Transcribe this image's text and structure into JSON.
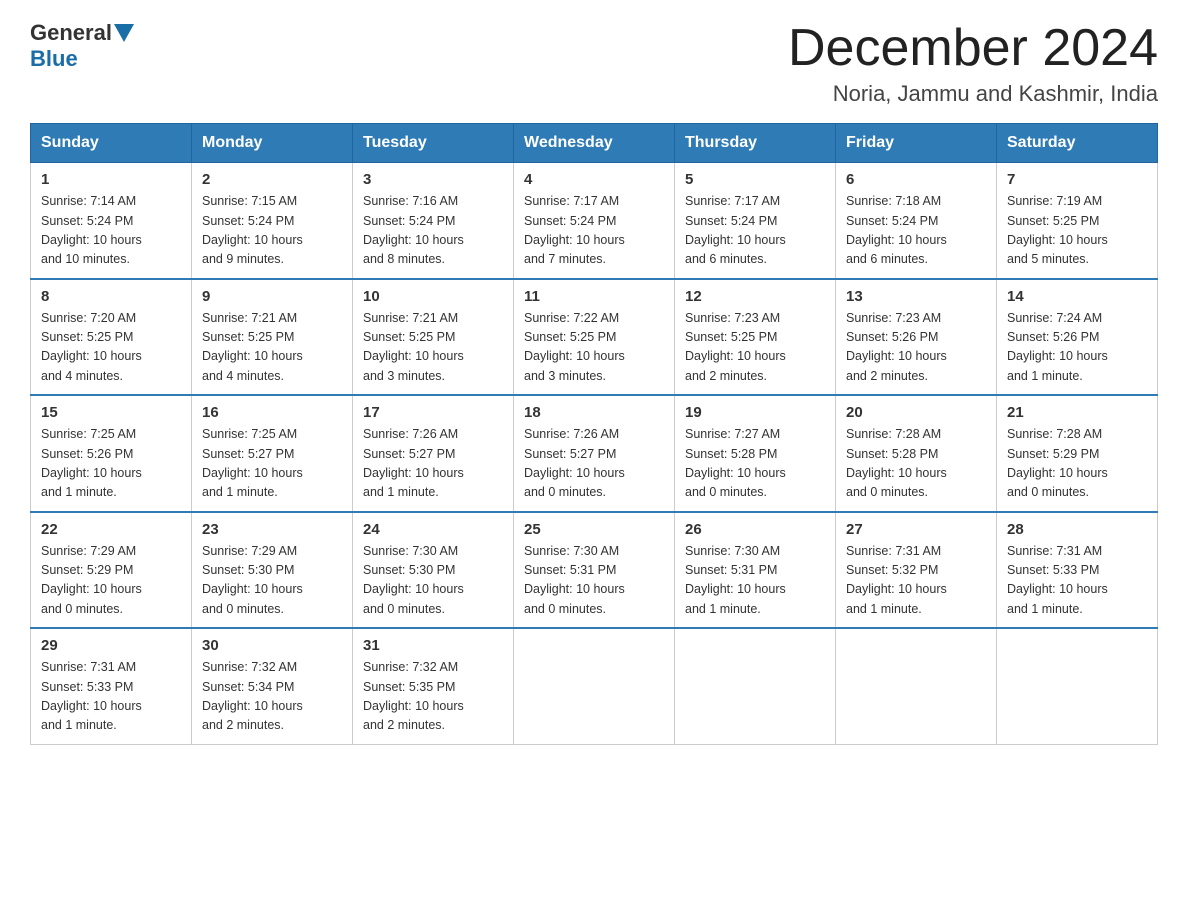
{
  "header": {
    "logo_general": "General",
    "logo_blue": "Blue",
    "month_title": "December 2024",
    "location": "Noria, Jammu and Kashmir, India"
  },
  "days_of_week": [
    "Sunday",
    "Monday",
    "Tuesday",
    "Wednesday",
    "Thursday",
    "Friday",
    "Saturday"
  ],
  "weeks": [
    [
      {
        "day": "1",
        "sunrise": "7:14 AM",
        "sunset": "5:24 PM",
        "daylight": "10 hours and 10 minutes."
      },
      {
        "day": "2",
        "sunrise": "7:15 AM",
        "sunset": "5:24 PM",
        "daylight": "10 hours and 9 minutes."
      },
      {
        "day": "3",
        "sunrise": "7:16 AM",
        "sunset": "5:24 PM",
        "daylight": "10 hours and 8 minutes."
      },
      {
        "day": "4",
        "sunrise": "7:17 AM",
        "sunset": "5:24 PM",
        "daylight": "10 hours and 7 minutes."
      },
      {
        "day": "5",
        "sunrise": "7:17 AM",
        "sunset": "5:24 PM",
        "daylight": "10 hours and 6 minutes."
      },
      {
        "day": "6",
        "sunrise": "7:18 AM",
        "sunset": "5:24 PM",
        "daylight": "10 hours and 6 minutes."
      },
      {
        "day": "7",
        "sunrise": "7:19 AM",
        "sunset": "5:25 PM",
        "daylight": "10 hours and 5 minutes."
      }
    ],
    [
      {
        "day": "8",
        "sunrise": "7:20 AM",
        "sunset": "5:25 PM",
        "daylight": "10 hours and 4 minutes."
      },
      {
        "day": "9",
        "sunrise": "7:21 AM",
        "sunset": "5:25 PM",
        "daylight": "10 hours and 4 minutes."
      },
      {
        "day": "10",
        "sunrise": "7:21 AM",
        "sunset": "5:25 PM",
        "daylight": "10 hours and 3 minutes."
      },
      {
        "day": "11",
        "sunrise": "7:22 AM",
        "sunset": "5:25 PM",
        "daylight": "10 hours and 3 minutes."
      },
      {
        "day": "12",
        "sunrise": "7:23 AM",
        "sunset": "5:25 PM",
        "daylight": "10 hours and 2 minutes."
      },
      {
        "day": "13",
        "sunrise": "7:23 AM",
        "sunset": "5:26 PM",
        "daylight": "10 hours and 2 minutes."
      },
      {
        "day": "14",
        "sunrise": "7:24 AM",
        "sunset": "5:26 PM",
        "daylight": "10 hours and 1 minute."
      }
    ],
    [
      {
        "day": "15",
        "sunrise": "7:25 AM",
        "sunset": "5:26 PM",
        "daylight": "10 hours and 1 minute."
      },
      {
        "day": "16",
        "sunrise": "7:25 AM",
        "sunset": "5:27 PM",
        "daylight": "10 hours and 1 minute."
      },
      {
        "day": "17",
        "sunrise": "7:26 AM",
        "sunset": "5:27 PM",
        "daylight": "10 hours and 1 minute."
      },
      {
        "day": "18",
        "sunrise": "7:26 AM",
        "sunset": "5:27 PM",
        "daylight": "10 hours and 0 minutes."
      },
      {
        "day": "19",
        "sunrise": "7:27 AM",
        "sunset": "5:28 PM",
        "daylight": "10 hours and 0 minutes."
      },
      {
        "day": "20",
        "sunrise": "7:28 AM",
        "sunset": "5:28 PM",
        "daylight": "10 hours and 0 minutes."
      },
      {
        "day": "21",
        "sunrise": "7:28 AM",
        "sunset": "5:29 PM",
        "daylight": "10 hours and 0 minutes."
      }
    ],
    [
      {
        "day": "22",
        "sunrise": "7:29 AM",
        "sunset": "5:29 PM",
        "daylight": "10 hours and 0 minutes."
      },
      {
        "day": "23",
        "sunrise": "7:29 AM",
        "sunset": "5:30 PM",
        "daylight": "10 hours and 0 minutes."
      },
      {
        "day": "24",
        "sunrise": "7:30 AM",
        "sunset": "5:30 PM",
        "daylight": "10 hours and 0 minutes."
      },
      {
        "day": "25",
        "sunrise": "7:30 AM",
        "sunset": "5:31 PM",
        "daylight": "10 hours and 0 minutes."
      },
      {
        "day": "26",
        "sunrise": "7:30 AM",
        "sunset": "5:31 PM",
        "daylight": "10 hours and 1 minute."
      },
      {
        "day": "27",
        "sunrise": "7:31 AM",
        "sunset": "5:32 PM",
        "daylight": "10 hours and 1 minute."
      },
      {
        "day": "28",
        "sunrise": "7:31 AM",
        "sunset": "5:33 PM",
        "daylight": "10 hours and 1 minute."
      }
    ],
    [
      {
        "day": "29",
        "sunrise": "7:31 AM",
        "sunset": "5:33 PM",
        "daylight": "10 hours and 1 minute."
      },
      {
        "day": "30",
        "sunrise": "7:32 AM",
        "sunset": "5:34 PM",
        "daylight": "10 hours and 2 minutes."
      },
      {
        "day": "31",
        "sunrise": "7:32 AM",
        "sunset": "5:35 PM",
        "daylight": "10 hours and 2 minutes."
      },
      null,
      null,
      null,
      null
    ]
  ],
  "labels": {
    "sunrise": "Sunrise:",
    "sunset": "Sunset:",
    "daylight": "Daylight:"
  }
}
